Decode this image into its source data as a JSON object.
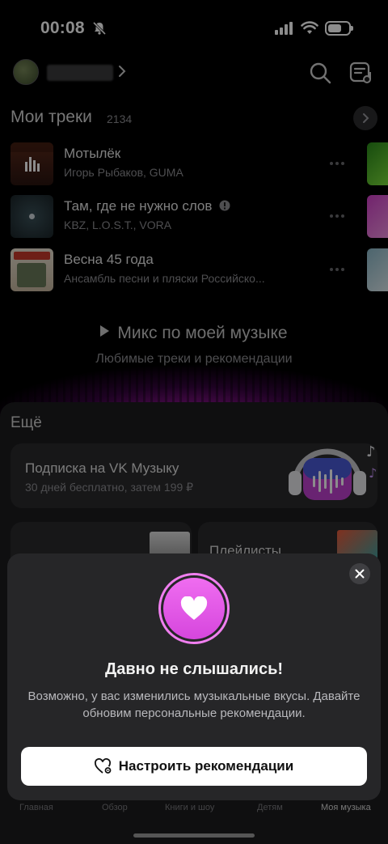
{
  "status_bar": {
    "time": "00:08"
  },
  "header": {
    "search_icon": "search-icon",
    "queue_icon": "playlist-icon"
  },
  "my_tracks": {
    "title": "Мои треки",
    "count": "2134",
    "tracks": [
      {
        "title": "Мотылёк",
        "artist": "Игорь Рыбаков, GUMA"
      },
      {
        "title": "Там, где не нужно слов",
        "artist": "KBZ, L.O.S.T., VORA"
      },
      {
        "title": "Весна 45 года",
        "artist": "Ансамбль песни и пляски Российско..."
      }
    ]
  },
  "mix": {
    "title": "Микс по моей музыке",
    "subtitle": "Любимые треки и рекомендации"
  },
  "more": {
    "title": "Ещё",
    "subscription": {
      "title": "Подписка на VK Музыку",
      "desc": "30 дней бесплатно, затем 199 ₽"
    },
    "playlists_label": "Плейлисты"
  },
  "modal": {
    "title": "Давно не слышались!",
    "text": "Возможно, у вас изменились музыкальные вкусы. Давайте обновим персональные рекомендации.",
    "cta": "Настроить рекомендации"
  },
  "nav": {
    "items": [
      "Главная",
      "Обзор",
      "Книги и шоу",
      "Детям",
      "Моя музыка"
    ],
    "active": "Моя музыка"
  },
  "colors": {
    "accent": "#e35ae6",
    "background": "#000000",
    "panel": "#1c1c1e"
  }
}
